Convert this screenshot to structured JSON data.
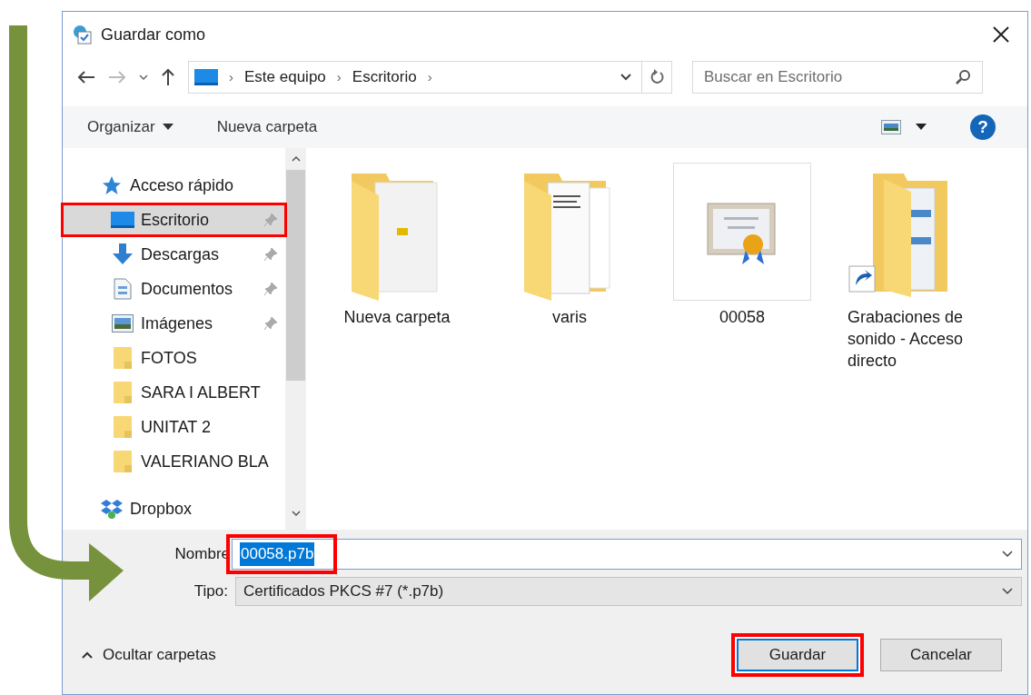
{
  "window": {
    "title": "Guardar como"
  },
  "address_bar": {
    "breadcrumbs": [
      "Este equipo",
      "Escritorio"
    ],
    "separator": "›"
  },
  "help": "?",
  "search": {
    "placeholder": "Buscar en Escritorio"
  },
  "toolbar": {
    "organize": "Organizar",
    "new_folder": "Nueva carpeta"
  },
  "sidebar": {
    "items": [
      {
        "label": "Acceso rápido",
        "kind": "star",
        "selected": false,
        "pinned": false,
        "highlighted": false,
        "children": [
          {
            "label": "Escritorio",
            "kind": "desktop",
            "selected": true,
            "pinned": true,
            "highlighted": true
          },
          {
            "label": "Descargas",
            "kind": "download",
            "selected": false,
            "pinned": true,
            "highlighted": false
          },
          {
            "label": "Documentos",
            "kind": "documents",
            "selected": false,
            "pinned": true,
            "highlighted": false
          },
          {
            "label": "Imágenes",
            "kind": "pictures",
            "selected": false,
            "pinned": true,
            "highlighted": false
          },
          {
            "label": "FOTOS",
            "kind": "folder",
            "selected": false,
            "pinned": false,
            "highlighted": false
          },
          {
            "label": "SARA I ALBERT",
            "kind": "folder",
            "selected": false,
            "pinned": false,
            "highlighted": false
          },
          {
            "label": "UNITAT 2",
            "kind": "folder",
            "selected": false,
            "pinned": false,
            "highlighted": false
          },
          {
            "label": "VALERIANO BLA",
            "kind": "folder",
            "selected": false,
            "pinned": false,
            "highlighted": false
          }
        ]
      },
      {
        "label": "Dropbox",
        "kind": "dropbox",
        "selected": false,
        "pinned": false,
        "highlighted": false
      }
    ]
  },
  "files": [
    {
      "name": "Nueva carpeta",
      "kind": "folder-doc"
    },
    {
      "name": "varis",
      "kind": "folder-pages"
    },
    {
      "name": "00058",
      "kind": "certificate"
    },
    {
      "name": "Grabaciones de sonido - Acceso directo",
      "kind": "shortcut-folder"
    }
  ],
  "filename": {
    "label": "Nombre",
    "value": "00058.p7b",
    "highlighted": true
  },
  "filetype": {
    "label": "Tipo:",
    "value": "Certificados PKCS #7 (*.p7b)"
  },
  "hide_folders": "Ocultar carpetas",
  "buttons": [
    {
      "label": "Guardar",
      "highlighted": true
    },
    {
      "label": "Cancelar",
      "highlighted": false
    }
  ]
}
